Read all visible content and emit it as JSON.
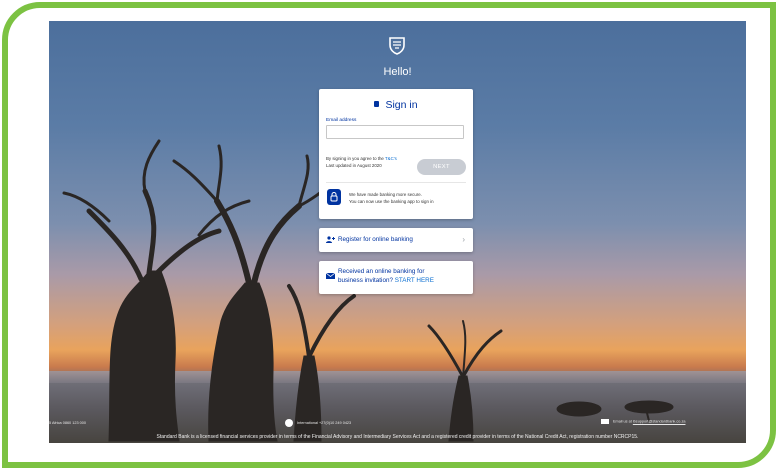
{
  "brand": {
    "icon": "standard-bank-shield-icon"
  },
  "greeting": "Hello!",
  "signin": {
    "title": "Sign in",
    "email_label": "Email address",
    "email_value": "",
    "email_placeholder": "",
    "terms_prefix": "By signing in you agree to the",
    "terms_link": "T&C's",
    "terms_updated": "Last updated in August 2020",
    "next_label": "NEXT",
    "secure_line1": "We have made banking more secure.",
    "secure_line2": "You can now use the banking app to sign in"
  },
  "register": {
    "label": "Register for online banking",
    "chevron": "›"
  },
  "business": {
    "line1": "Received an online banking for",
    "line2_prefix": "business invitation?",
    "start_link": "START HERE"
  },
  "footer": {
    "left": "5 Africa 0860 123 000",
    "international": "International +27(0)10 249 0423",
    "email_prefix": "Email us at",
    "email": "ibsupport@standardbank.co.za",
    "legal": "Standard Bank is a licensed financial services provider in terms of the Financial Advisory and Intermediary Services Act and a registered credit provider in terms of the National Credit Act, registration number NCRCP15."
  },
  "colors": {
    "frame": "#7cc242",
    "brand_blue": "#0033a0",
    "link": "#0a6ed1",
    "next_disabled": "#c8ccd3"
  }
}
